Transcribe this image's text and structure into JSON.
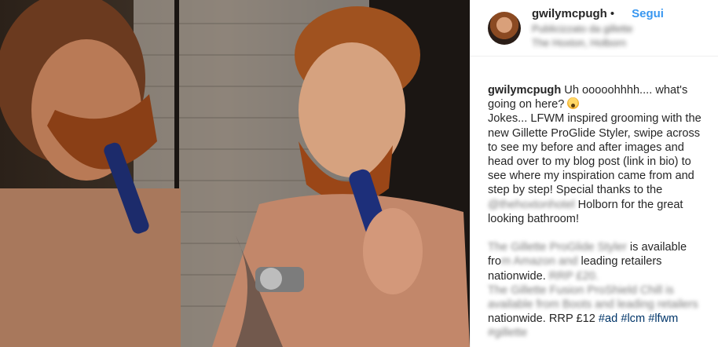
{
  "post": {
    "author": {
      "username": "gwilymcpugh",
      "separator": "•",
      "follow_label": "Segui",
      "location_line1": "Publicizzato da gillette",
      "location_line2": "The Hoxton, Holborn"
    },
    "caption": {
      "username": "gwilymcpugh",
      "line1_a": " Uh ooooohhhh.... what's going on here? ",
      "emoji_icon": "scream-emoji-icon",
      "line2": "Jokes... LFWM inspired grooming with the new Gillette ProGlide Styler, swipe across to see my before and after images and head over to my blog post (link in bio) to see where my inspiration came from and step by step! Special thanks to the ",
      "blur_mention": "@thehoxtonhotel",
      "line3": " Holborn for the great looking bathroom!",
      "para2_blur1": "The Gillette ProGlide Styler",
      "para2_a": " is available ",
      "para2_b": "fro",
      "para2_blur2": "m Amazon and",
      "para2_c": " leading retailers nationwide. ",
      "para2_blur3": "RRP £20.",
      "para2_blur4": "The Gillette Fusion ProShield Chill is available from Boots and leading retailers",
      "para2_d": "nationwide. RRP £12 ",
      "hashtags": [
        "#ad",
        "#lcm",
        "#lfwm"
      ],
      "blur_tag": "#gillette"
    }
  },
  "colors": {
    "link": "#3897f0",
    "hashtag": "#003569",
    "text": "#262626"
  }
}
